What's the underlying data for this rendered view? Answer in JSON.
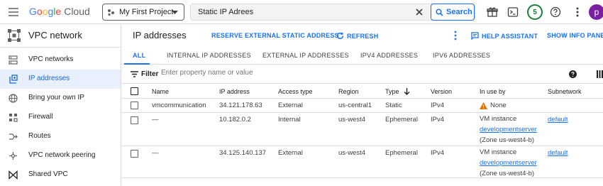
{
  "topbar": {
    "logo_google": [
      "G",
      "o",
      "o",
      "g",
      "l",
      "e"
    ],
    "logo_cloud": "Cloud",
    "project_name": "My First Project",
    "search_value": "Static IP Adrees",
    "search_button": "Search",
    "notifications_count": "5",
    "avatar_letter": "p"
  },
  "sidebar": {
    "title": "VPC network",
    "items": [
      {
        "label": "VPC networks",
        "icon": "vpc-networks-icon"
      },
      {
        "label": "IP addresses",
        "icon": "ip-addresses-icon",
        "active": true
      },
      {
        "label": "Bring your own IP",
        "icon": "globe-icon"
      },
      {
        "label": "Firewall",
        "icon": "firewall-icon"
      },
      {
        "label": "Routes",
        "icon": "routes-icon"
      },
      {
        "label": "VPC network peering",
        "icon": "peering-icon"
      },
      {
        "label": "Shared VPC",
        "icon": "shared-vpc-icon"
      }
    ]
  },
  "main": {
    "title": "IP addresses",
    "reserve_label": "RESERVE EXTERNAL STATIC ADDRESS",
    "refresh_label": "REFRESH",
    "help_assistant_label": "HELP ASSISTANT",
    "info_panel_label": "SHOW INFO PANEL",
    "tabs": [
      {
        "label": "ALL",
        "active": true
      },
      {
        "label": "INTERNAL IP ADDRESSES"
      },
      {
        "label": "EXTERNAL IP ADDRESSES"
      },
      {
        "label": "IPV4 ADDRESSES"
      },
      {
        "label": "IPV6 ADDRESSES"
      }
    ],
    "filter_label": "Filter",
    "filter_placeholder": "Enter property name or value",
    "columns": [
      "Name",
      "IP address",
      "Access type",
      "Region",
      "Type",
      "Version",
      "In use by",
      "Subnetwork"
    ],
    "rows": [
      {
        "name": "vmcommunication",
        "ip": "34.121.178.63",
        "access": "External",
        "region": "us-central1",
        "type": "Static",
        "version": "IPv4",
        "inuse_status": "None",
        "subnetwork": ""
      },
      {
        "name": "—",
        "ip": "10.182.0.2",
        "access": "Internal",
        "region": "us-west4",
        "type": "Ephemeral",
        "version": "IPv4",
        "inuse_line1": "VM instance",
        "inuse_link": "developmentserver",
        "inuse_line3": "(Zone us-west4-b)",
        "subnetwork": "default"
      },
      {
        "name": "—",
        "ip": "34.125.140.137",
        "access": "External",
        "region": "us-west4",
        "type": "Ephemeral",
        "version": "IPv4",
        "inuse_line1": "VM instance",
        "inuse_link": "developmentserver",
        "inuse_line3": "(Zone us-west4-b)",
        "subnetwork": "default"
      }
    ]
  },
  "colors": {
    "accent": "#1a73e8",
    "warning": "#e37400",
    "active_bg": "#e8f0fe"
  }
}
